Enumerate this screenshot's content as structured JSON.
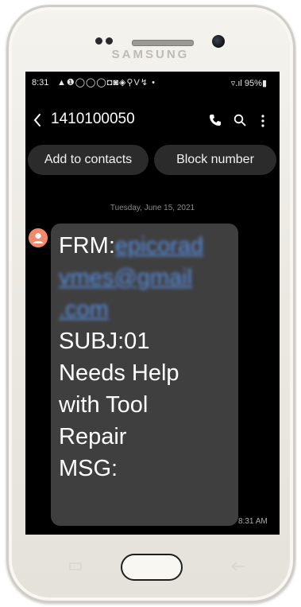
{
  "device": {
    "brand": "SAMSUNG"
  },
  "status_bar": {
    "time": "8:31",
    "notification_icons": "▲❶◯◯◯◘◙◈⚲V↯ •",
    "battery": "95%"
  },
  "conversation": {
    "contact_number": "1410100050",
    "actions": {
      "add_to_contacts": "Add to contacts",
      "block_number": "Block number"
    },
    "date": "Tuesday, June 15, 2021",
    "message": {
      "from_label": "FRM:",
      "email_line1": "epicorad",
      "email_line2": "vmes@gmail",
      "email_line3": ".com",
      "subj_line": "SUBJ:01",
      "body_line1": "Needs Help",
      "body_line2": "with Tool",
      "body_line3": "Repair",
      "msg_label": "MSG:",
      "time": "8:31 AM"
    }
  },
  "colors": {
    "screen_bg": "#000000",
    "bubble_bg": "#3f3f3f",
    "pill_bg": "#2b2b2b",
    "link": "#5a8fe3",
    "avatar": "#f08a6a"
  },
  "icons": [
    "back-icon",
    "call-icon",
    "search-icon",
    "more-icon",
    "avatar-icon",
    "recents-icon",
    "back-key-icon"
  ]
}
